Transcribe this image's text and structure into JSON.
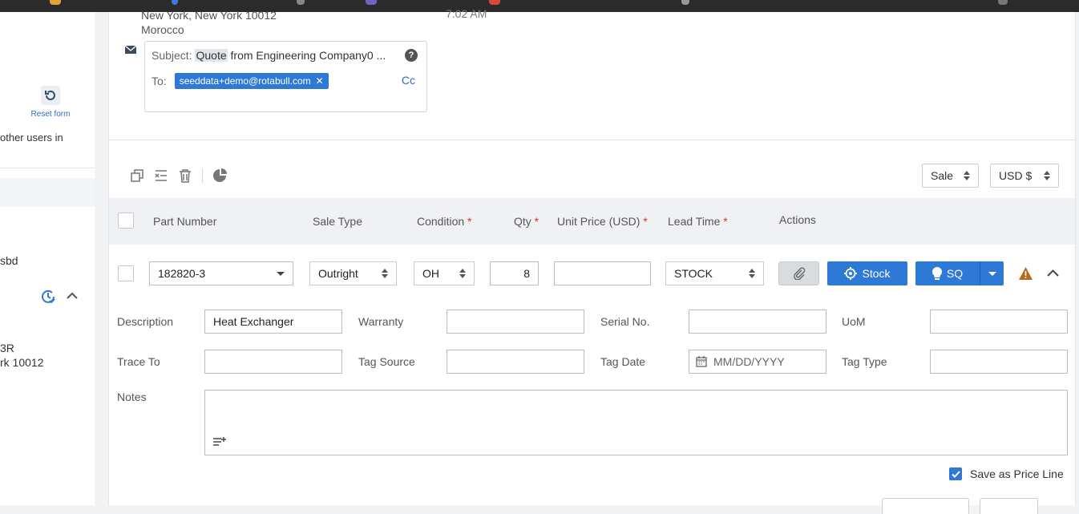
{
  "left_panel": {
    "reset_label": "Reset form",
    "other_users_text": "other users in",
    "sbd_text": "sbd",
    "addr_line1": "3R",
    "addr_line2": "rk 10012"
  },
  "header": {
    "address_line1": "New York, New York 10012",
    "address_line2": "Morocco",
    "time_partial": "7:02 AM"
  },
  "email": {
    "subject_label": "Subject:",
    "subject_highlight": "Quote",
    "subject_rest": " from Engineering Company0 ...",
    "help_glyph": "?",
    "to_label": "To:",
    "recipient": "seeddata+demo@rotabull.com",
    "remove_glyph": "✕",
    "cc_label": "Cc"
  },
  "toolbar": {
    "icons": [
      "copy-icon",
      "remove-lines-icon",
      "trash-icon",
      "pie-chart-icon"
    ],
    "sale_select": "Sale",
    "currency_select": "USD $"
  },
  "table": {
    "headers": {
      "part_number": "Part Number",
      "sale_type": "Sale Type",
      "condition": "Condition",
      "qty": "Qty",
      "unit_price": "Unit Price (USD)",
      "lead_time": "Lead Time",
      "actions": "Actions"
    },
    "required_mark": "*",
    "row": {
      "part_number": "182820-3",
      "sale_type": "Outright",
      "condition": "OH",
      "qty": "8",
      "unit_price": "",
      "lead_time": "STOCK",
      "stock_button": "Stock",
      "sq_button": "SQ"
    }
  },
  "details": {
    "description_label": "Description",
    "description_value": "Heat Exchanger",
    "warranty_label": "Warranty",
    "warranty_value": "",
    "serial_label": "Serial No.",
    "serial_value": "",
    "uom_label": "UoM",
    "uom_value": "",
    "trace_label": "Trace To",
    "trace_value": "",
    "tag_source_label": "Tag Source",
    "tag_source_value": "",
    "tag_date_label": "Tag Date",
    "tag_date_placeholder": "MM/DD/YYYY",
    "tag_type_label": "Tag Type",
    "tag_type_value": "",
    "notes_label": "Notes",
    "save_price_label": "Save as Price Line",
    "save_price_checked": true
  },
  "colors": {
    "accent": "#2f79d6",
    "warning": "#b86a1a",
    "required": "#d0342c"
  }
}
